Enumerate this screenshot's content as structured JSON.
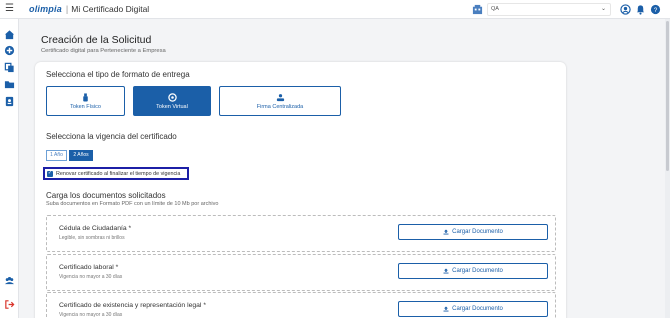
{
  "header": {
    "logo": "olimpia",
    "separator": "|",
    "title": "Mi Certificado Digital",
    "company_value": "QA"
  },
  "page": {
    "title": "Creación de la Solicitud",
    "subtitle": "Certificado digital para Perteneciente a Empresa"
  },
  "format_section": {
    "title": "Selecciona el tipo de formato de entrega",
    "options": [
      {
        "label": "Token Físico",
        "icon": "usb-token-icon",
        "selected": false
      },
      {
        "label": "Token Virtual",
        "icon": "cloud-token-icon",
        "selected": true
      },
      {
        "label": "Firma Centralizada",
        "icon": "centralized-signature-icon",
        "selected": false
      }
    ]
  },
  "validity_section": {
    "title": "Selecciona la vigencia del certificado",
    "options": [
      {
        "label": "1 Año",
        "selected": false
      },
      {
        "label": "2 Años",
        "selected": true
      }
    ],
    "renew_label": "Renovar certificado al finalizar el tiempo de vigencia",
    "renew_checked": true
  },
  "documents_section": {
    "title": "Carga los documentos solicitados",
    "subtitle": "Suba documentos en Formato PDF con un límite de 10 Mb por archivo",
    "upload_label": "Cargar Documento",
    "items": [
      {
        "name": "Cédula de Ciudadanía *",
        "desc": "Legible, sin sombras ni brillos"
      },
      {
        "name": "Certificado laboral *",
        "desc": "Vigencia no mayor a 30 días"
      },
      {
        "name": "Certificado de existencia y representación legal *",
        "desc": "Vigencia no mayor a 30 días"
      }
    ]
  },
  "colors": {
    "primary": "#1b5fa8",
    "highlight_border": "#1c1fa6",
    "background": "#f3f4f6"
  }
}
